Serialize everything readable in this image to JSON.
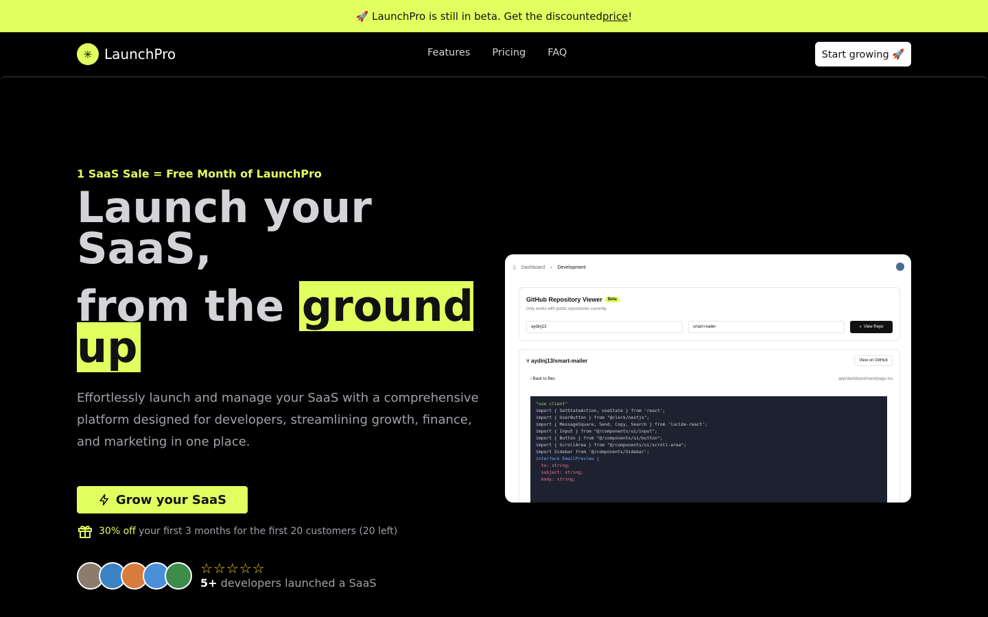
{
  "banner": {
    "prefix": "🚀 LaunchPro is still in beta. Get the discounted ",
    "link": "price",
    "suffix": "!"
  },
  "nav": {
    "logo_glyph": "✳",
    "brand": "LaunchPro",
    "links": [
      "Features",
      "Pricing",
      "FAQ"
    ],
    "cta": "Start growing 🚀"
  },
  "hero": {
    "kicker": "1 SaaS Sale = Free Month of LaunchPro",
    "title_line1": "Launch your SaaS,",
    "title_line2_prefix": "from the ",
    "title_highlight": "ground up",
    "subtitle": "Effortlessly launch and manage your SaaS with a comprehensive platform designed for developers, streamlining growth, finance, and marketing in one place.",
    "cta": "Grow your SaaS",
    "offer_accent": "30% off",
    "offer_text": " your first 3 months for the first 20 customers (20 left)",
    "stars": "☆☆☆☆☆",
    "proof_count": "5+",
    "proof_text": " developers launched a SaaS",
    "avatar_colors": [
      "#8b7d6b",
      "#3b82c4",
      "#d97b3a",
      "#4a90d9",
      "#3d8c4a"
    ]
  },
  "screenshot": {
    "crumb1": "Dashboard",
    "crumb2": "Development",
    "card_title": "GitHub Repository Viewer",
    "badge": "Beta",
    "card_sub": "Only works with public repositories currently.",
    "input_user": "aydinj13",
    "input_repo": "smart-mailer",
    "view_repo": "View Repo",
    "repo_title": "aydinj13/smart-mailer",
    "view_github": "View on GitHub",
    "back": "Back to files",
    "path": "app/dashboard/send/page.tsx",
    "code": [
      "\"use client\"",
      "",
      "import { SetStateAction, useState } from 'react';",
      "import { UserButton } from \"@clerk/nextjs\";",
      "import { MessageSquare, Send, Copy, Search } from 'lucide-react';",
      "import { Input } from \"@/components/ui/input\";",
      "import { Button } from \"@/components/ui/button\";",
      "import { ScrollArea } from \"@/components/ui/scroll-area\";",
      "import Sidebar from '@/components/Sidebar';",
      "",
      "",
      "interface EmailPreview {",
      "  to: string;",
      "  subject: string;",
      "  body: string;"
    ]
  }
}
